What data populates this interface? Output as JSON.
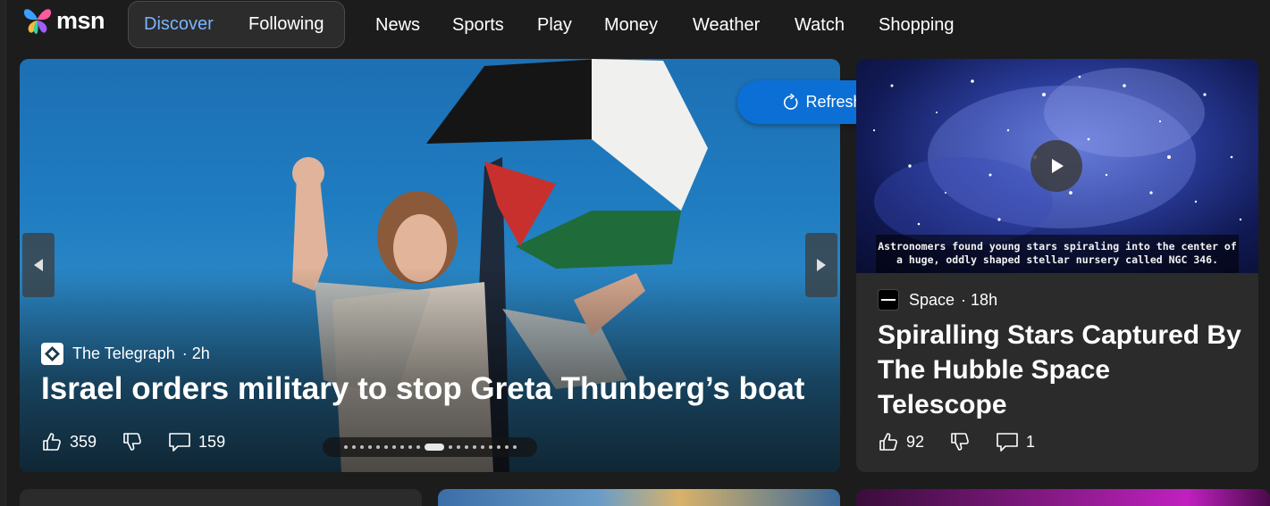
{
  "brand": {
    "name": "msn"
  },
  "nav": {
    "segments": [
      {
        "label": "Discover",
        "active": true
      },
      {
        "label": "Following",
        "active": false
      }
    ],
    "items": [
      "News",
      "Sports",
      "Play",
      "Money",
      "Weather",
      "Watch",
      "Shopping"
    ]
  },
  "refresh": {
    "label": "Refresh stories",
    "icon": "refresh-icon"
  },
  "hero": {
    "source": "The Telegraph",
    "age": "· 2h",
    "title": "Israel orders military to stop Greta Thunberg’s boat",
    "likes": "359",
    "comments": "159",
    "carousel_total": 20,
    "carousel_active_index": 10
  },
  "side": {
    "caption": "Astronomers found young stars spiraling into the center of a huge, oddly shaped stellar nursery called NGC 346.",
    "source": "Space",
    "age": "· 18h",
    "title": "Spiralling Stars Captured By The Hubble Space Telescope",
    "likes": "92",
    "comments": "1"
  },
  "colors": {
    "background": "#1c1c1c",
    "accent": "#7ab4ff",
    "refresh_button": "#0b6fd6",
    "card": "#2b2b2b"
  }
}
